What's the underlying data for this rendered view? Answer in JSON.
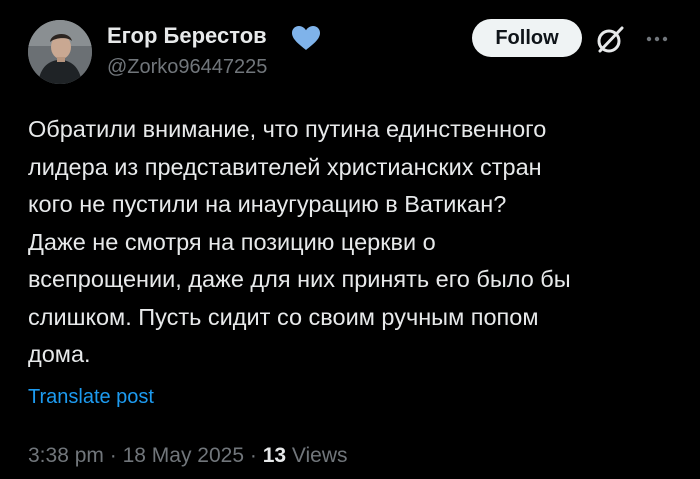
{
  "author": {
    "display_name": "Егор Берестов",
    "handle": "@Zorko96447225",
    "verified_badge_icon": "blue-heart-icon",
    "verified_badge_color": "#7fb3ea"
  },
  "actions": {
    "follow_label": "Follow",
    "grok_icon": "grok-icon",
    "more_icon": "more-dots-icon"
  },
  "post": {
    "text": "Обратили внимание, что путина единственного\nлидера из представителей христианских стран\nкого не пустили на инаугурацию в Ватикан?\nДаже не смотря на позицию церкви о\nвсепрощении, даже для них принять его было бы\nслишком. Пусть сидит со своим ручным попом\nдома.",
    "translate_label": "Translate post"
  },
  "meta": {
    "time": "3:38 pm",
    "separator": "·",
    "date": "18 May 2025",
    "views_count": "13",
    "views_label": "Views"
  },
  "colors": {
    "background": "#000000",
    "text_primary": "#e7e9ea",
    "text_secondary": "#71767b",
    "link": "#1d9bf0",
    "follow_button_bg": "#eff3f4",
    "follow_button_text": "#0f1419"
  }
}
